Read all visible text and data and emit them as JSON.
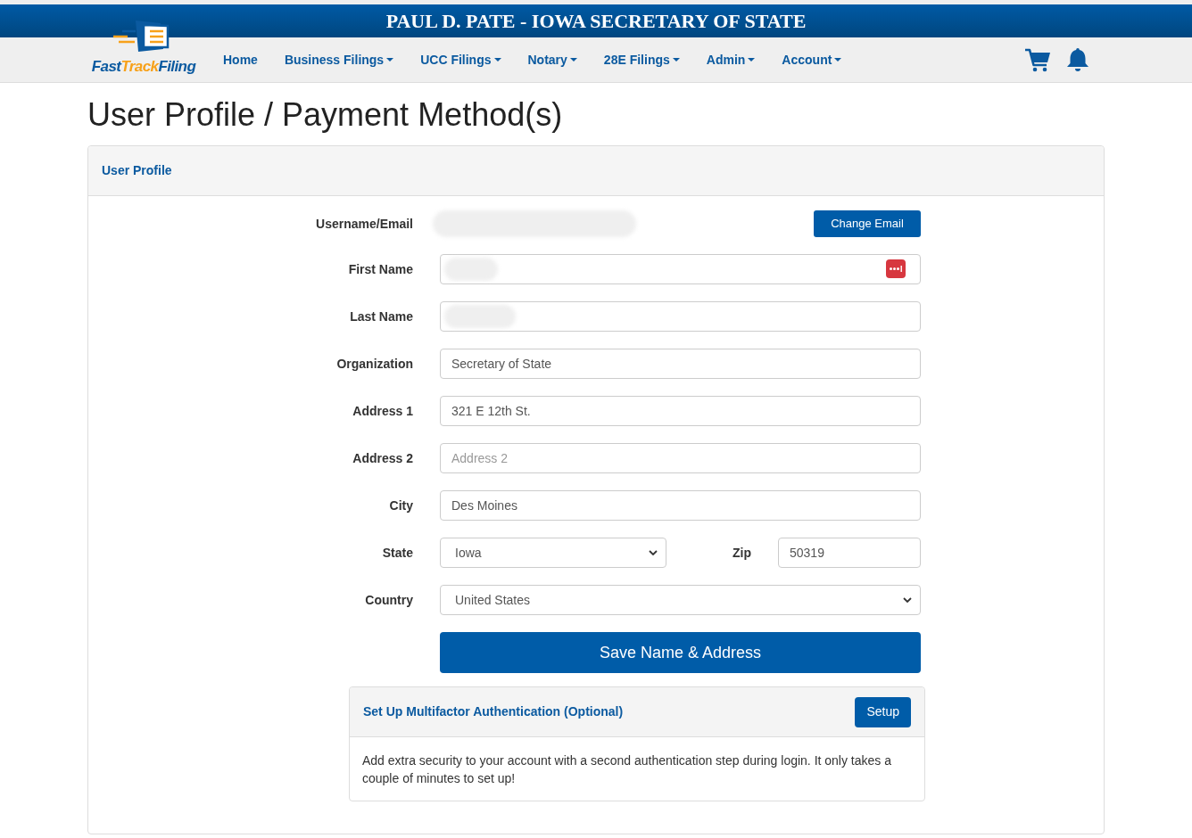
{
  "banner": {
    "title": "PAUL D. PATE - IOWA SECRETARY OF STATE"
  },
  "logo": {
    "parts": [
      {
        "text": "Fast",
        "accent": false
      },
      {
        "text": "Track",
        "accent": true
      },
      {
        "text": "Filing",
        "accent": false
      }
    ]
  },
  "nav": {
    "items": [
      {
        "label": "Home",
        "dropdown": false
      },
      {
        "label": "Business Filings",
        "dropdown": true
      },
      {
        "label": "UCC Filings",
        "dropdown": true
      },
      {
        "label": "Notary",
        "dropdown": true
      },
      {
        "label": "28E Filings",
        "dropdown": true
      },
      {
        "label": "Admin",
        "dropdown": true
      },
      {
        "label": "Account",
        "dropdown": true
      }
    ]
  },
  "page_title": "User Profile / Payment Method(s)",
  "profile_panel": {
    "title": "User Profile",
    "username": {
      "label": "Username/Email",
      "redacted": true,
      "button": "Change Email"
    },
    "rows": [
      {
        "kind": "text",
        "label": "First Name",
        "redacted": true,
        "autofill_icon": true
      },
      {
        "kind": "text",
        "label": "Last Name",
        "redacted": true
      },
      {
        "kind": "text",
        "label": "Organization",
        "value": "Secretary of State"
      },
      {
        "kind": "text",
        "label": "Address 1",
        "value": "321 E 12th St."
      },
      {
        "kind": "text",
        "label": "Address 2",
        "placeholder": "Address 2"
      },
      {
        "kind": "text",
        "label": "City",
        "value": "Des Moines"
      },
      {
        "kind": "split",
        "label": "State",
        "value": "Iowa",
        "second_label": "Zip",
        "second_value": "50319"
      },
      {
        "kind": "select",
        "label": "Country",
        "value": "United States"
      }
    ],
    "save_button": "Save Name & Address",
    "mfa_panel": {
      "title": "Set Up Multifactor Authentication (Optional)",
      "button": "Setup",
      "text": "Add extra security to your account with a second authentication step during login. It only takes a couple of minutes to set up!"
    }
  }
}
